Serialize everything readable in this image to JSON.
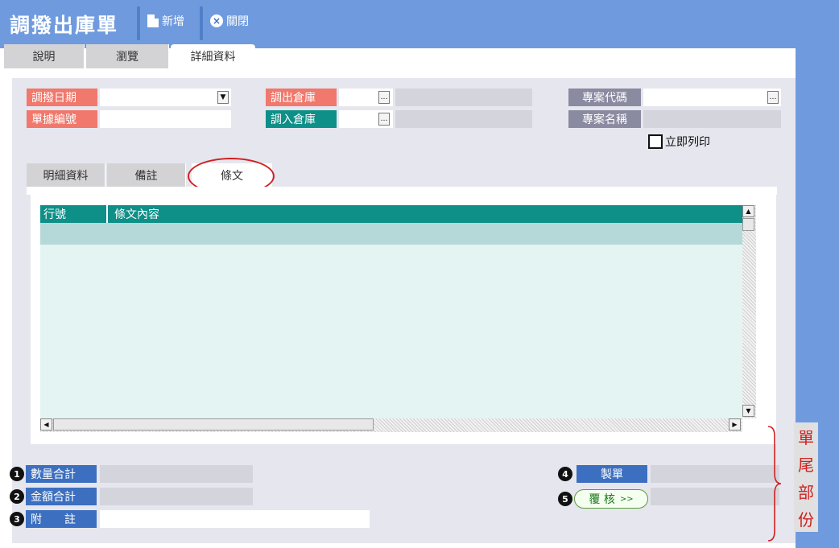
{
  "header": {
    "title": "調撥出庫單",
    "buttons": [
      {
        "label": "新增",
        "icon": "new-document-icon"
      },
      {
        "label": "關閉",
        "icon": "close-circle-icon"
      }
    ]
  },
  "tabs": [
    "說明",
    "瀏覽",
    "詳細資料"
  ],
  "active_tab": "詳細資料",
  "form": {
    "transfer_date": {
      "label": "調撥日期",
      "value": ""
    },
    "doc_no": {
      "label": "單據編號",
      "value": ""
    },
    "out_warehouse": {
      "label": "調出倉庫",
      "value": ""
    },
    "in_warehouse": {
      "label": "調入倉庫",
      "value": ""
    },
    "project_code": {
      "label": "專案代碼",
      "value": ""
    },
    "project_name": {
      "label": "專案名稱",
      "value": ""
    },
    "print_now": {
      "label": "立即列印",
      "checked": false
    }
  },
  "subtabs": [
    "明細資料",
    "備註",
    "條文"
  ],
  "active_subtab": "條文",
  "grid": {
    "columns": [
      "行號",
      "條文內容"
    ],
    "rows": []
  },
  "footer": {
    "qty_total": {
      "num": "1",
      "label": "數量合計",
      "value": ""
    },
    "amount_total": {
      "num": "2",
      "label": "金額合計",
      "value": ""
    },
    "remark": {
      "num": "3",
      "label": "附　　註",
      "value": ""
    },
    "maker": {
      "num": "4",
      "label": "製單",
      "value": ""
    },
    "approve": {
      "num": "5",
      "label": "覆 核",
      "arrow": ">>",
      "value": ""
    }
  },
  "side_note": [
    "單",
    "尾",
    "部",
    "份"
  ],
  "colors": {
    "header_blue": "#6f9bde",
    "label_red": "#f0786c",
    "label_teal": "#0e8f87",
    "label_gray": "#8a8aa0",
    "label_blue": "#3c6fc0",
    "grid_body": "#e4f4f3",
    "annotation_red": "#d02020"
  }
}
